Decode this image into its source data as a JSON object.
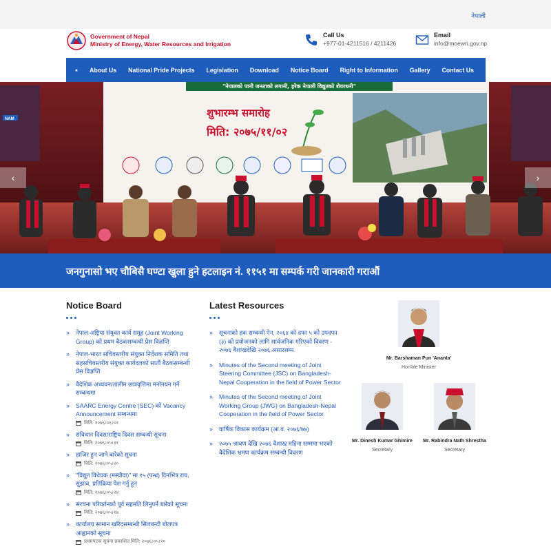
{
  "top": {
    "language": "नेपाली"
  },
  "header": {
    "org_line1": "Government of Nepal",
    "org_line2": "Ministry of Energy, Water Resources and Irrigation",
    "call_title": "Call Us",
    "call_value": "+977-01-4211516 / 4211426",
    "email_title": "Email",
    "email_value": "info@moewri.gov.np"
  },
  "nav": {
    "items": [
      "About Us",
      "National Pride Projects",
      "Legislation",
      "Download",
      "Notice Board",
      "Right to Information",
      "Gallery",
      "Contact Us"
    ]
  },
  "banner": {
    "slogan": "\"नेपालको पानी जनताको लगानी, हरेक नेपाली विद्युतको शेयरधनी\"",
    "event_title": "शुभारम्भ समारोह",
    "event_date": "मिति: २०७५/११/०२",
    "sign_text": "NAM"
  },
  "hotline": {
    "text": "जनगुनासो भए चौबिसै घण्टा खुला हुने हटलाइन नं. ११५१ मा सम्पर्क गरी जानकारी गराऔं"
  },
  "notice_board": {
    "title": "Notice Board",
    "items": [
      {
        "title": "नेपाल-अष्ट्रिया संयुक्त कार्य समूह (Joint Working Group) को प्रथम बैठकसम्बन्धी प्रेस विज्ञप्ति",
        "date": ""
      },
      {
        "title": "नेपाल-भारत सचिवस्तरीय संयुक्त निर्देशक समिति तथा सहसचिवस्तरीय संयुक्त कार्यदलको सातौं बैठकसम्बन्धी प्रेस विज्ञप्ति",
        "date": ""
      },
      {
        "title": "वैदेशिक अध्ययन/तालीम छात्रवृत्तिमा मनोनयन गर्ने सम्बन्धमा",
        "date": ""
      },
      {
        "title": "SAARC Energy Centre (SEC) को Vacancy Announcement सम्बन्धमा",
        "date": "मिति: २०७६।०६।०१"
      },
      {
        "title": "संविधान दिवस/राष्ट्रिय दिवस सम्बन्धी सूचना",
        "date": "मिति: २०७६।०५।३१"
      },
      {
        "title": "हाजिर हुन जाने बारेको सूचना",
        "date": "मिति: २०७६।०५।२० "
      },
      {
        "title": "\"विद्युत विधेयक (मस्यौदा)\" मा १५ (पन्ध्र) दिनभित्र राय, सुझाव, प्रतिक्रिया पेश गर्नु हुन",
        "date": "मिति: २०७६।०५।२४"
      },
      {
        "title": "संरचना परिवर्तनको पूर्व सहमति लिनुपर्ने बारेको सूचना",
        "date": "मिति: २०७६।०५।१७"
      },
      {
        "title": "कार्यालय सामान खरिदसम्बन्धी सिलबन्दी बोलपत्र आह्वानको सूचना",
        "date": "प्रथमपटक सूचना प्रकाशित मिति: २०७६।०५।१० "
      }
    ]
  },
  "resources": {
    "title": "Latest Resources",
    "items": [
      "सूचनाको हक सम्बन्धी ऐन, २०६४ को दफा ५ को उपदफा (३) को प्रयोजनको लागि सार्वजनिक गरिएको विवरण - २०७६ वैशाखदेखि २०७६ असारसम्म",
      "Minutes of the Second meeting of Joint Steering Committee (JSC) on Bangladesh-Nepal Cooperation in the field of Power Sector",
      "Minutes of the Second meeting of Joint Working Group (JWG) on Bangladesh-Nepal Cooperation in the field of Power Sector",
      "वार्षिक विकास कार्यक्रम (आ.व. २०७६/७७)",
      "२०७५ श्रावण देखि २०७६ वैशाख महिना सम्ममा भएको वैदेशिक भ्रमण कार्यक्रम सम्बन्धी विवरण"
    ]
  },
  "officials": [
    {
      "name": "Mr. Barshaman Pun 'Ananta'",
      "role": "Hon'ble Minister"
    },
    {
      "name": "Mr. Dinesh Kumar Ghimire",
      "role": "Secretary"
    },
    {
      "name": "Mr. Rabindra Nath Shrestha",
      "role": "Secretary"
    }
  ],
  "colors": {
    "brand_blue": "#1f5dbd",
    "brand_red": "#c8102e"
  },
  "icons": [
    "home-icon",
    "phone-icon",
    "mail-icon",
    "calendar-icon",
    "chevron-left-icon",
    "chevron-right-icon"
  ]
}
